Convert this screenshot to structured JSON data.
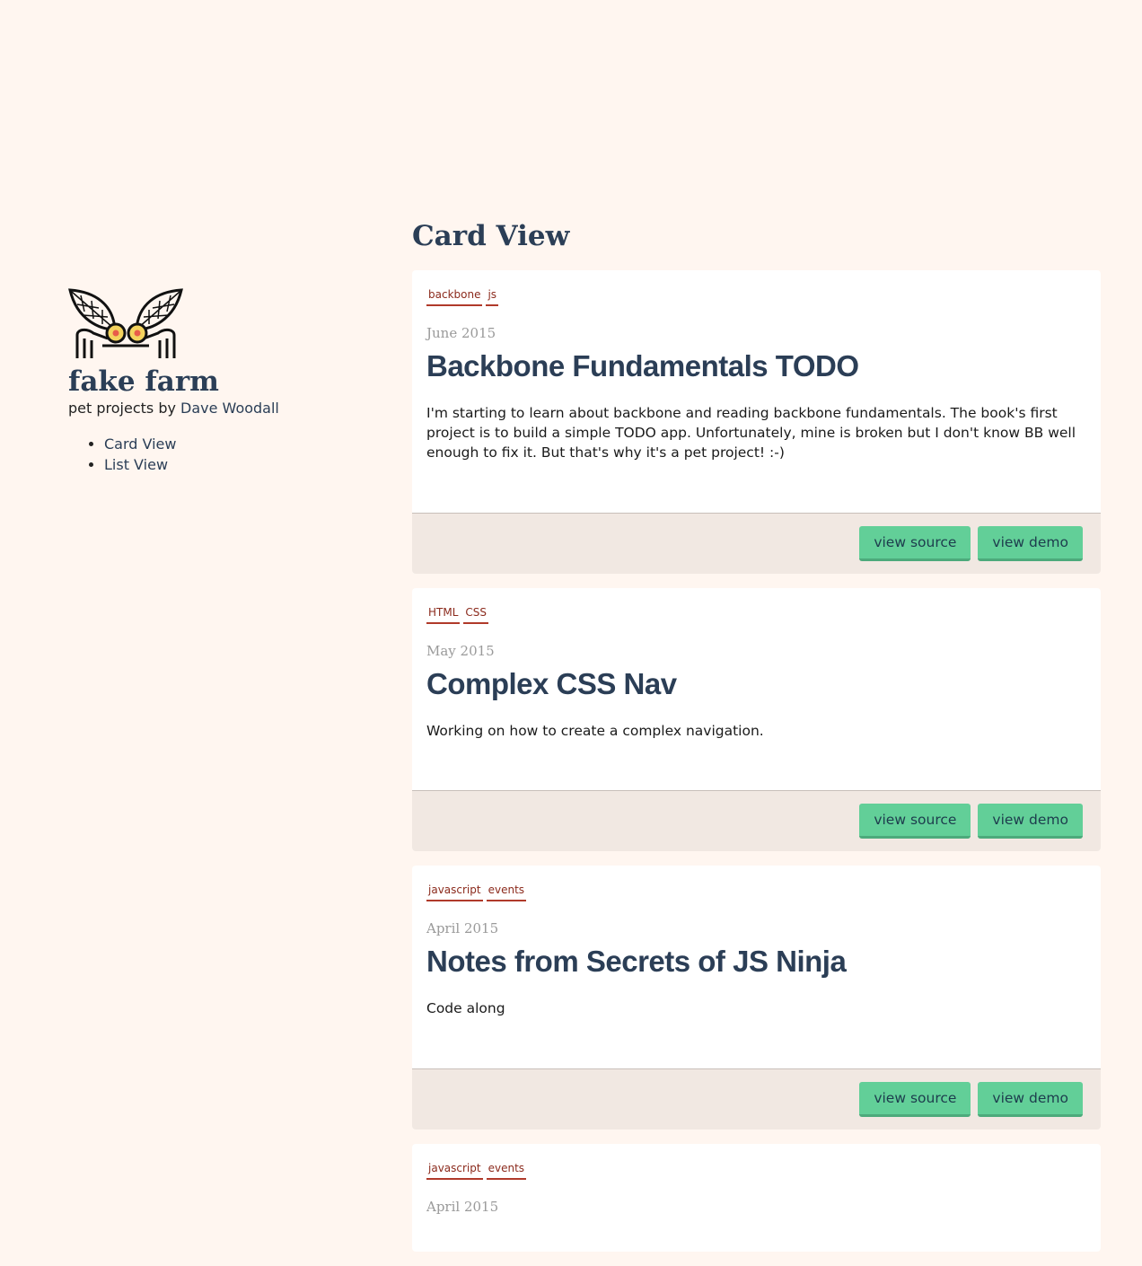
{
  "site": {
    "title": "fake farm",
    "tagline_prefix": "pet projects by ",
    "author": "Dave Woodall"
  },
  "nav": [
    {
      "label": "Card View"
    },
    {
      "label": "List View"
    }
  ],
  "page_title": "Card View",
  "cards": [
    {
      "tags": [
        "backbone",
        "js"
      ],
      "date": "June 2015",
      "title": "Backbone Fundamentals TODO",
      "description": "I'm starting to learn about backbone and reading backbone fundamentals. The book's first project is to build a simple TODO app. Unfortunately, mine is broken but I don't know BB well enough to fix it. But that's why it's a pet project! :-)",
      "source_label": "view source",
      "demo_label": "view demo"
    },
    {
      "tags": [
        "HTML",
        "CSS"
      ],
      "date": "May 2015",
      "title": "Complex CSS Nav",
      "description": "Working on how to create a complex navigation.",
      "source_label": "view source",
      "demo_label": "view demo"
    },
    {
      "tags": [
        "javascript",
        "events"
      ],
      "date": "April 2015",
      "title": "Notes from Secrets of JS Ninja",
      "description": "Code along",
      "source_label": "view source",
      "demo_label": "view demo"
    },
    {
      "tags": [
        "javascript",
        "events"
      ],
      "date": "April 2015"
    }
  ],
  "colors": {
    "background": "#fff6f0",
    "heading": "#2b3e56",
    "tag": "#8b2a1c",
    "button": "#62cf98",
    "footer": "#f1e8e2"
  }
}
